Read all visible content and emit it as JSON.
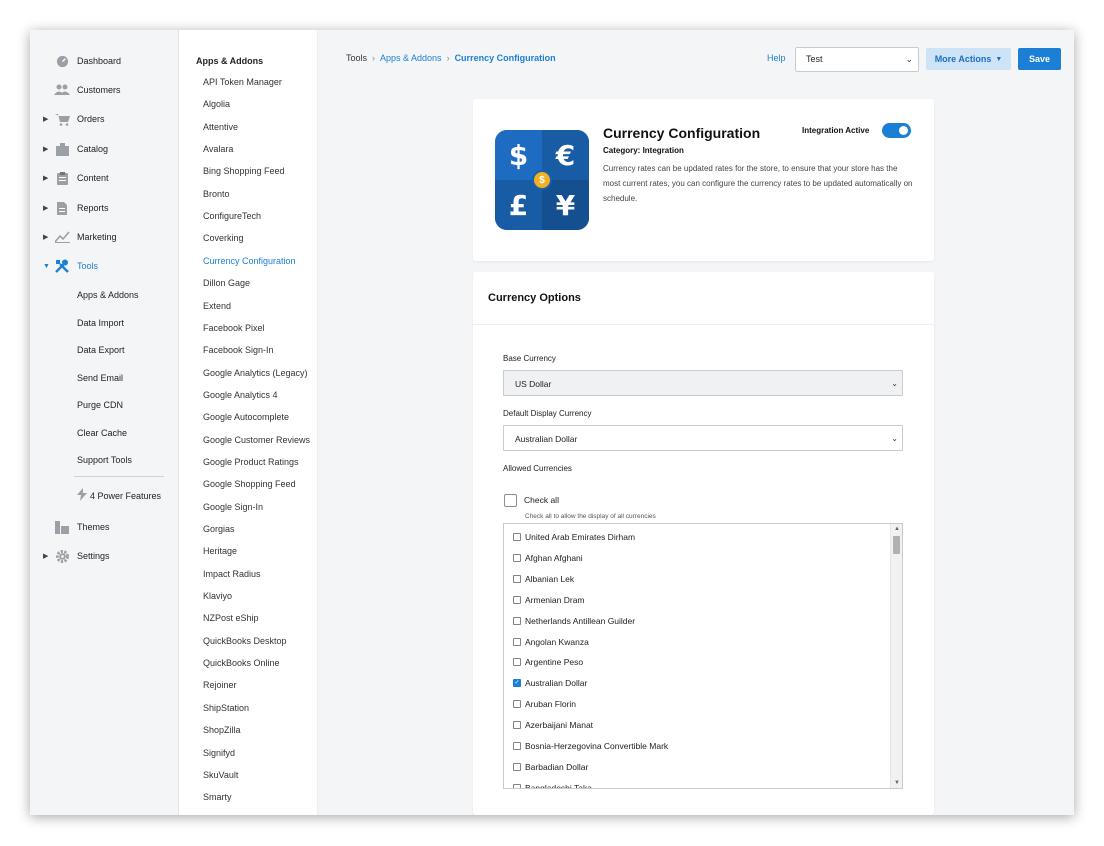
{
  "nav": {
    "items": [
      {
        "label": "Dashboard",
        "icon": "dashboard-icon",
        "has_caret": false
      },
      {
        "label": "Customers",
        "icon": "customers-icon",
        "has_caret": false
      },
      {
        "label": "Orders",
        "icon": "cart-icon",
        "has_caret": true
      },
      {
        "label": "Catalog",
        "icon": "catalog-icon",
        "has_caret": true
      },
      {
        "label": "Content",
        "icon": "content-icon",
        "has_caret": true
      },
      {
        "label": "Reports",
        "icon": "reports-icon",
        "has_caret": true
      },
      {
        "label": "Marketing",
        "icon": "marketing-icon",
        "has_caret": true
      },
      {
        "label": "Tools",
        "icon": "tools-icon",
        "has_caret": true,
        "active": true
      }
    ],
    "tools_sub": [
      "Apps & Addons",
      "Data Import",
      "Data Export",
      "Send Email",
      "Purge CDN",
      "Clear Cache",
      "Support Tools"
    ],
    "power_features": "4 Power Features",
    "themes": "Themes",
    "settings": "Settings"
  },
  "addons": {
    "title": "Apps & Addons",
    "items": [
      "API Token Manager",
      "Algolia",
      "Attentive",
      "Avalara",
      "Bing Shopping Feed",
      "Bronto",
      "ConfigureTech",
      "Coverking",
      "Currency Configuration",
      "Dillon Gage",
      "Extend",
      "Facebook Pixel",
      "Facebook Sign-In",
      "Google Analytics (Legacy)",
      "Google Analytics 4",
      "Google Autocomplete",
      "Google Customer Reviews",
      "Google Product Ratings",
      "Google Shopping Feed",
      "Google Sign-In",
      "Gorgias",
      "Heritage",
      "Impact Radius",
      "Klaviyo",
      "NZPost eShip",
      "QuickBooks Desktop",
      "QuickBooks Online",
      "Rejoiner",
      "ShipStation",
      "ShopZilla",
      "Signifyd",
      "SkuVault",
      "Smarty"
    ],
    "active": "Currency Configuration"
  },
  "header": {
    "breadcrumb": [
      "Tools",
      "Apps & Addons",
      "Currency Configuration"
    ],
    "help": "Help",
    "store_select": "Test",
    "more_actions": "More Actions",
    "save": "Save"
  },
  "app": {
    "title": "Currency Configuration",
    "category": "Category: Integration",
    "description": "Currency rates can be updated rates for the store, to ensure that your store has the most current rates, you can configure the currency rates to be updated automatically on schedule.",
    "integration_label": "Integration Active",
    "integration_active": true,
    "logo_symbols": [
      "$",
      "€",
      "£",
      "¥",
      "$"
    ]
  },
  "options": {
    "section_title": "Currency Options",
    "base_currency_label": "Base Currency",
    "base_currency": "US Dollar",
    "display_currency_label": "Default Display Currency",
    "display_currency": "Australian Dollar",
    "allowed_label": "Allowed Currencies",
    "check_all": "Check all",
    "check_all_help": "Check all to allow the display of all currencies",
    "currencies": [
      {
        "name": "United Arab Emirates Dirham",
        "checked": false
      },
      {
        "name": "Afghan Afghani",
        "checked": false
      },
      {
        "name": "Albanian Lek",
        "checked": false
      },
      {
        "name": "Armenian Dram",
        "checked": false
      },
      {
        "name": "Netherlands Antillean Guilder",
        "checked": false
      },
      {
        "name": "Angolan Kwanza",
        "checked": false
      },
      {
        "name": "Argentine Peso",
        "checked": false
      },
      {
        "name": "Australian Dollar",
        "checked": true
      },
      {
        "name": "Aruban Florin",
        "checked": false
      },
      {
        "name": "Azerbaijani Manat",
        "checked": false
      },
      {
        "name": "Bosnia-Herzegovina Convertible Mark",
        "checked": false
      },
      {
        "name": "Barbadian Dollar",
        "checked": false
      },
      {
        "name": "Bangladeshi Taka",
        "checked": false
      }
    ]
  },
  "colors": {
    "accent": "#1c7fd6",
    "sidebar_bg": "#f4f5f6"
  }
}
